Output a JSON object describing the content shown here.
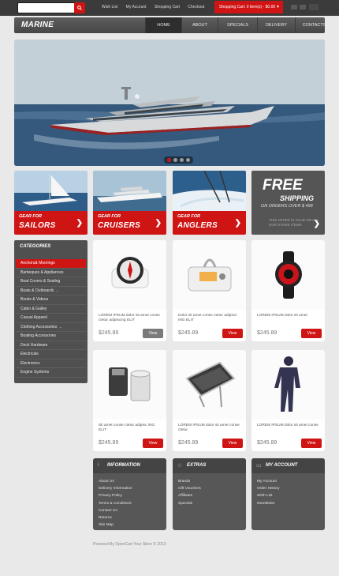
{
  "topbar": {
    "search_placeholder": "",
    "links": [
      "Wish List",
      "My Account",
      "Shopping Cart",
      "Checkout"
    ],
    "cart_label": "Shopping Cart: 0 item(s) - $0.00"
  },
  "header": {
    "logo": "MARINE",
    "nav": [
      "HOME",
      "ABOUT",
      "SPECIALS",
      "DELIVERY",
      "CONTACTS"
    ],
    "active_nav": 0
  },
  "slider": {
    "dots": 4,
    "active": 0
  },
  "promos": [
    {
      "small": "GEAR FOR",
      "big": "SAILORS"
    },
    {
      "small": "GEAR FOR",
      "big": "CRUISERS"
    },
    {
      "small": "GEAR FOR",
      "big": "ANGLERS"
    }
  ],
  "free_shipping": {
    "line1": "FREE",
    "line2": "SHIPPING",
    "line3": "ON ORDERS OVER $ 499",
    "line4": "THIS OFFER IS VALID ON ALL OUR STORE ITEMS"
  },
  "categories": {
    "title": "CATEGORIES",
    "items": [
      "Anchors& Moorings",
      "Barbeques & Appliances",
      "Boat Covers & Sealing",
      "Boats & Outboards  →",
      "Books & Videos",
      "Cabin & Galley",
      "Casual Apparel",
      "Clothing Accessories  →",
      "Boating Accessories",
      "Deck Hardware",
      "Electricals",
      "Electronics",
      "Engine Systems"
    ],
    "active": 0
  },
  "products": [
    {
      "desc": "LOREM IPSUM dolor sit amet conse ctetur adipiscing ELIT",
      "price": "$245.89",
      "view": "View"
    },
    {
      "desc": "Dolor sit amet conse ctetur adipisci ING ELIT",
      "price": "$245.89",
      "view": "View"
    },
    {
      "desc": "LOREM IPSUM dolor sit amet",
      "price": "$245.89",
      "view": "View"
    },
    {
      "desc": "Sit amet conse ctetur adipisc ING ELIT",
      "price": "$245.89",
      "view": "View"
    },
    {
      "desc": "LOREM IPSUM dolor sit amet conse ctetur",
      "price": "$245.89",
      "view": "View"
    },
    {
      "desc": "LOREM IPSUM dolor sit amet conse",
      "price": "$245.89",
      "view": "View"
    }
  ],
  "footer": {
    "information": {
      "title": "INFORMATION",
      "links": [
        "About Us",
        "Delivery Information",
        "Privacy Policy",
        "Terms & Conditions",
        "Contact Us",
        "Returns",
        "Site Map"
      ]
    },
    "extras": {
      "title": "EXTRAS",
      "links": [
        "Brands",
        "Gift Vouchers",
        "Affiliates",
        "Specials"
      ]
    },
    "account": {
      "title": "MY ACCOUNT",
      "links": [
        "My Account",
        "Order History",
        "Wish List",
        "Newsletter"
      ]
    },
    "powered": "Powered By OpenCart Your Store © 2013"
  },
  "colors": {
    "accent": "#cf1414",
    "dark": "#3b3b3b",
    "panel": "#575757"
  }
}
